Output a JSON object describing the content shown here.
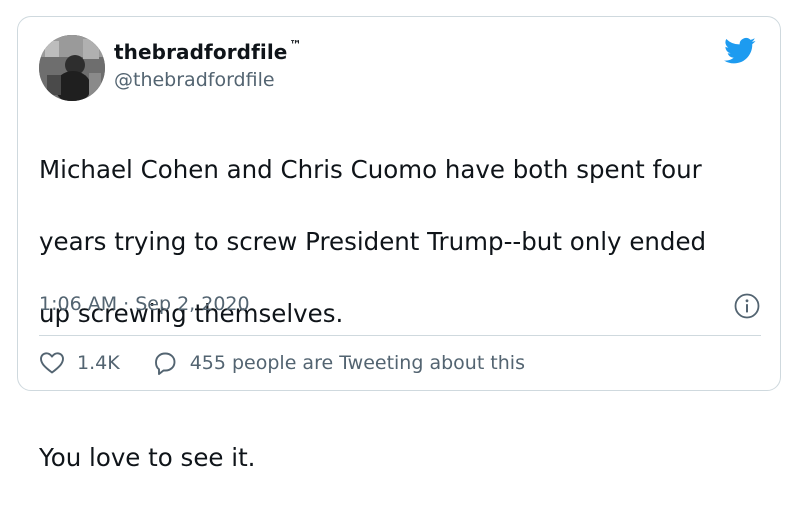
{
  "user": {
    "display_name": "thebradfordfile",
    "tm": "™",
    "handle": "@thebradfordfile"
  },
  "tweet": {
    "lines": [
      "Michael Cohen and Chris Cuomo have both spent four",
      "years trying to screw President Trump--but only ended",
      "up screwing themselves."
    ],
    "second_paragraph": "You love to see it.",
    "timestamp": "1:06 AM · Sep 2, 2020"
  },
  "actions": {
    "likes": "1.4K",
    "tweeting_about": "455 people are Tweeting about this"
  },
  "colors": {
    "brand": "#1d9bf0",
    "text": "#0f1419",
    "secondary": "#536471",
    "border": "#cfd9de"
  },
  "icons": [
    "twitter-bird-icon",
    "info-icon",
    "heart-icon",
    "speech-bubble-icon"
  ]
}
